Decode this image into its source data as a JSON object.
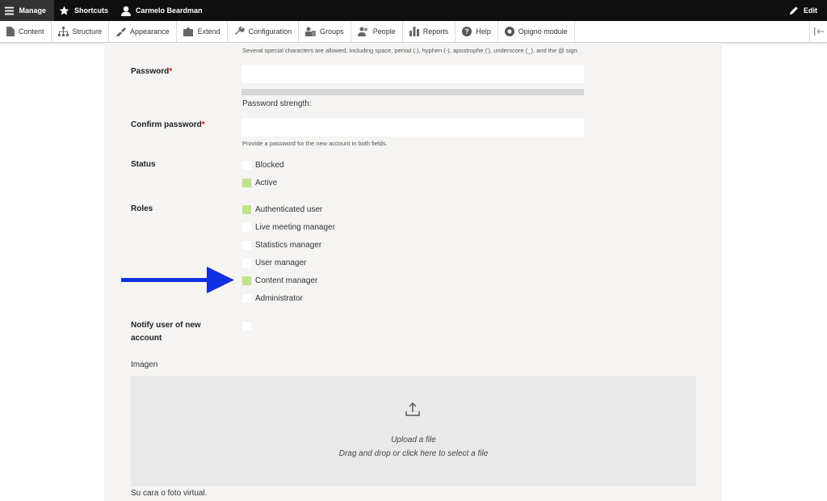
{
  "toolbar": {
    "manage": "Manage",
    "shortcuts": "Shortcuts",
    "user": "Carmelo Beardman",
    "edit": "Edit"
  },
  "tray": {
    "items": [
      "Content",
      "Structure",
      "Appearance",
      "Extend",
      "Configuration",
      "Groups",
      "People",
      "Reports",
      "Help",
      "Opigno module"
    ]
  },
  "form": {
    "username_help": "Several special characters are allowed, including space, period (.), hyphen (-), apostrophe ('), underscore (_), and the @ sign.",
    "password_label": "Password",
    "password_value": "",
    "password_strength_label": "Password strength:",
    "password_strength": 0,
    "confirm_label": "Confirm password",
    "confirm_value": "",
    "confirm_help": "Provide a password for the new account in both fields.",
    "required_marker": "*",
    "status": {
      "label": "Status",
      "options": [
        {
          "label": "Blocked",
          "checked": false
        },
        {
          "label": "Active",
          "checked": true
        }
      ]
    },
    "roles": {
      "label": "Roles",
      "options": [
        {
          "label": "Authenticated user",
          "checked": true
        },
        {
          "label": "Live meeting manager",
          "checked": false
        },
        {
          "label": "Statistics manager",
          "checked": false
        },
        {
          "label": "User manager",
          "checked": false
        },
        {
          "label": "Content manager",
          "checked": true
        },
        {
          "label": "Administrator",
          "checked": false
        }
      ]
    },
    "notify_label_1": "Notify user of new",
    "notify_label_2": "account",
    "notify_checked": false,
    "image_label": "Imagen",
    "upload_line1": "Upload a file",
    "upload_line2": "Drag and drop or click here to select a file",
    "image_help": "Su cara o foto virtual."
  },
  "colors": {
    "checked": "#bfe28a",
    "arrow": "#1030e0",
    "toolbar_bg": "#0f0f0f"
  }
}
